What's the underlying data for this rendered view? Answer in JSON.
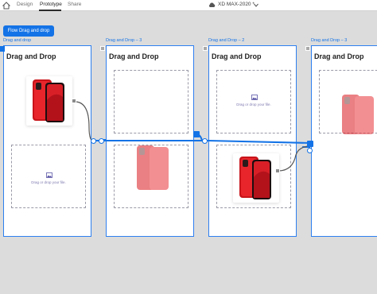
{
  "topbar": {
    "tabs": [
      "Design",
      "Prototype",
      "Share"
    ],
    "doc_title": "XD MAX-2020 *"
  },
  "flow_button": {
    "label": "Flow Drag and drop"
  },
  "artboards": [
    {
      "label": "Drag and drop",
      "title": "Drag and Drop"
    },
    {
      "label": "Drag and Drop – 3",
      "title": "Drag and Drop"
    },
    {
      "label": "Drag and Drop – 2",
      "title": "Drag and Drop"
    },
    {
      "label": "Drag and Drop – 3",
      "title": "Drag and Drop"
    }
  ],
  "dropzone_text": "Drag or drop your file.",
  "colors": {
    "accent": "#1473e6",
    "phone_red": "#d9191e",
    "canvas": "#dcdcdc"
  }
}
